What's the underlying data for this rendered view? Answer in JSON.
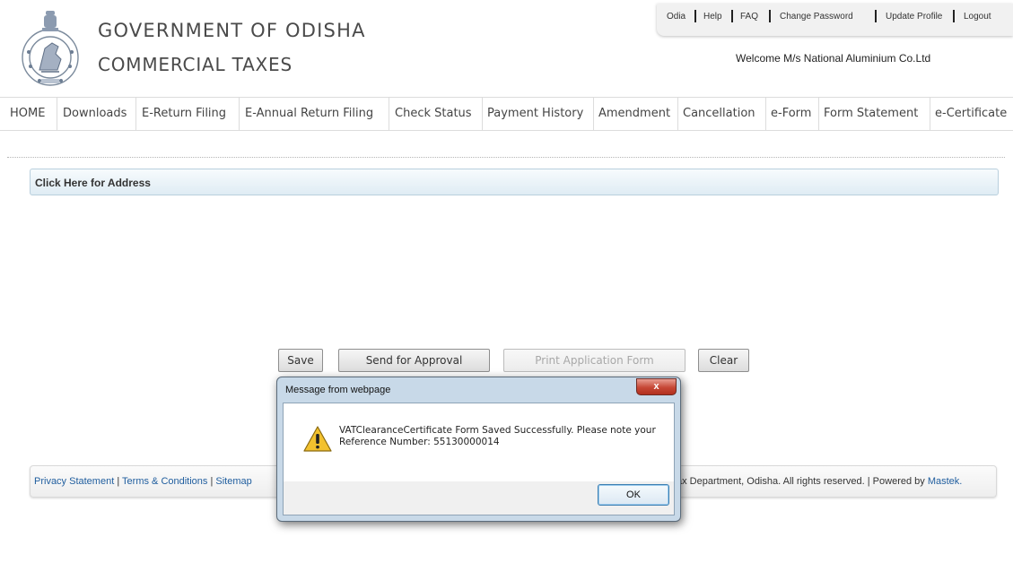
{
  "header": {
    "title": "GOVERNMENT OF ODISHA",
    "subtitle": "COMMERCIAL TAXES",
    "welcome": "Welcome M/s National Aluminium Co.Ltd",
    "top_links": [
      "Odia",
      "Help",
      "FAQ",
      "Change Password",
      "Update Profile",
      "Logout"
    ]
  },
  "nav": {
    "items": [
      "HOME",
      "Downloads",
      "E-Return Filing",
      "E-Annual Return Filing",
      "Check Status",
      "Payment History",
      "Amendment",
      "Cancellation",
      "e-Form",
      "Form Statement",
      "e-Certificate"
    ]
  },
  "address_bar": {
    "label": "Click Here for Address"
  },
  "form_buttons": {
    "save": "Save",
    "send_for_approval": "Send for Approval",
    "print_application_form": "Print Application Form",
    "clear": "Clear"
  },
  "footer": {
    "privacy": "Privacy Statement",
    "terms": "Terms & Conditions",
    "sitemap": "Sitemap",
    "separator": " | ",
    "rights": "ax Department, Odisha. All rights reserved. | Powered by ",
    "powered_by": "Mastek."
  },
  "dialog": {
    "title": "Message from webpage",
    "close_label": "x",
    "message": "VATClearanceCertificate Form Saved Successfully. Please note your Reference Number: 55130000014",
    "ok_label": "OK"
  },
  "colors": {
    "link": "#1f5d9e",
    "dialog_frame": "#c8d9e8",
    "close_red": "#c64735",
    "warning_yellow": "#f2c12e"
  }
}
